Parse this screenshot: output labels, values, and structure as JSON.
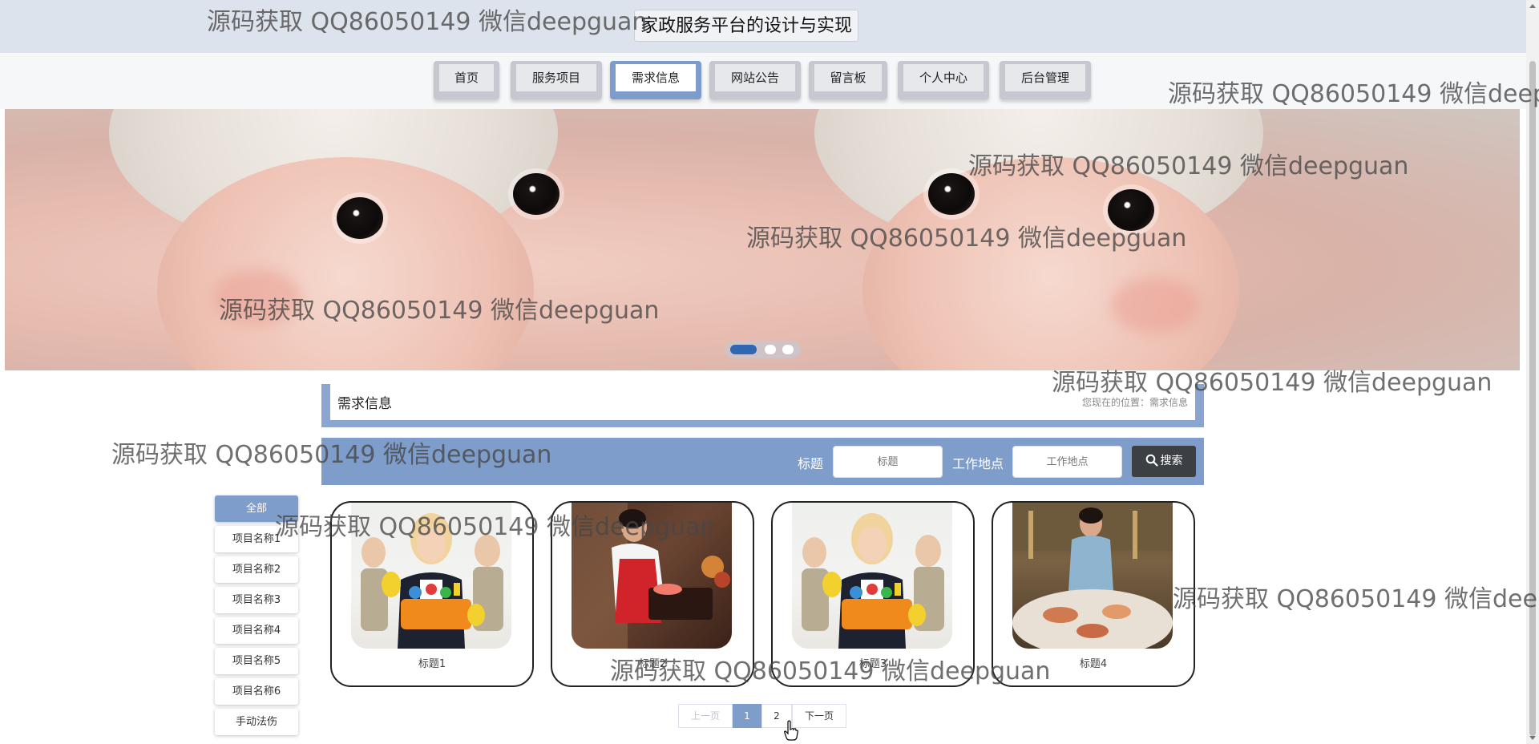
{
  "header": {
    "title": "家政服务平台的设计与实现"
  },
  "nav": {
    "items": [
      {
        "label": "首页"
      },
      {
        "label": "服务项目"
      },
      {
        "label": "需求信息",
        "active": true
      },
      {
        "label": "网站公告"
      },
      {
        "label": "留言板"
      },
      {
        "label": "个人中心"
      },
      {
        "label": "后台管理"
      }
    ]
  },
  "banner": {
    "slide_count": 3,
    "active_slide": 1
  },
  "breadcrumb": {
    "title": "需求信息",
    "path": "您现在的位置：需求信息"
  },
  "search": {
    "title_label": "标题",
    "title_placeholder": "标题",
    "location_label": "工作地点",
    "location_placeholder": "工作地点",
    "button_label": "搜索"
  },
  "categories": [
    {
      "label": "全部",
      "active": true
    },
    {
      "label": "项目名称1"
    },
    {
      "label": "项目名称2"
    },
    {
      "label": "项目名称3"
    },
    {
      "label": "项目名称4"
    },
    {
      "label": "项目名称5"
    },
    {
      "label": "项目名称6"
    },
    {
      "label": "手动法伤"
    }
  ],
  "cards": [
    {
      "title": "标题1"
    },
    {
      "title": "标题2"
    },
    {
      "title": "标题3"
    },
    {
      "title": "标题4"
    }
  ],
  "pagination": {
    "prev": "上一页",
    "pages": [
      "1",
      "2"
    ],
    "current": "1",
    "next": "下一页"
  },
  "watermark": "源码获取 QQ86050149 微信deepguan",
  "colors": {
    "accent": "#7f9dca",
    "nav_active": "#7d9ccb",
    "search_button": "#3c3f44",
    "header_bg": "#dde3ec"
  }
}
